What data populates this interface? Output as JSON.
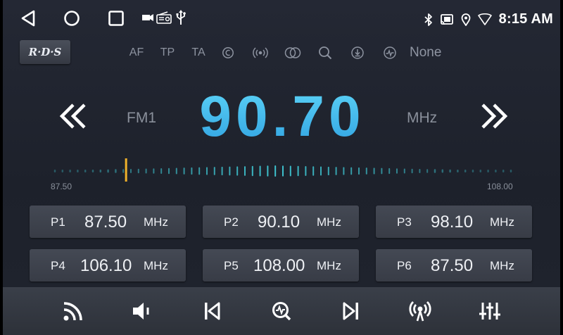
{
  "status": {
    "time": "8:15 AM"
  },
  "rds": {
    "button_label": "R·D·S",
    "options": [
      {
        "label": "AF",
        "icon": "af-text"
      },
      {
        "label": "TP",
        "icon": "tp-text"
      },
      {
        "label": "TA",
        "icon": "ta-text"
      },
      {
        "label": "",
        "icon": "pty-icon"
      },
      {
        "label": "",
        "icon": "broadcast-icon"
      },
      {
        "label": "",
        "icon": "stereo-icon"
      },
      {
        "label": "",
        "icon": "search-icon"
      },
      {
        "label": "",
        "icon": "download-icon"
      },
      {
        "label": "",
        "icon": "signal-icon"
      },
      {
        "label": "None",
        "icon": "none-text"
      }
    ]
  },
  "tuner": {
    "band": "FM1",
    "frequency": "90.70",
    "unit": "MHz",
    "range_min": "87.50",
    "range_max": "108.00",
    "range_min_value": 87.5,
    "range_max_value": 108.0,
    "frequency_value": 90.7
  },
  "presets": [
    {
      "label": "P1",
      "freq": "87.50",
      "unit": "MHz"
    },
    {
      "label": "P2",
      "freq": "90.10",
      "unit": "MHz"
    },
    {
      "label": "P3",
      "freq": "98.10",
      "unit": "MHz"
    },
    {
      "label": "P4",
      "freq": "106.10",
      "unit": "MHz"
    },
    {
      "label": "P5",
      "freq": "108.00",
      "unit": "MHz"
    },
    {
      "label": "P6",
      "freq": "87.50",
      "unit": "MHz"
    }
  ],
  "colors": {
    "accent": "#35b7ea",
    "needle": "#f0b12a",
    "tick": "#3ec3cf"
  }
}
